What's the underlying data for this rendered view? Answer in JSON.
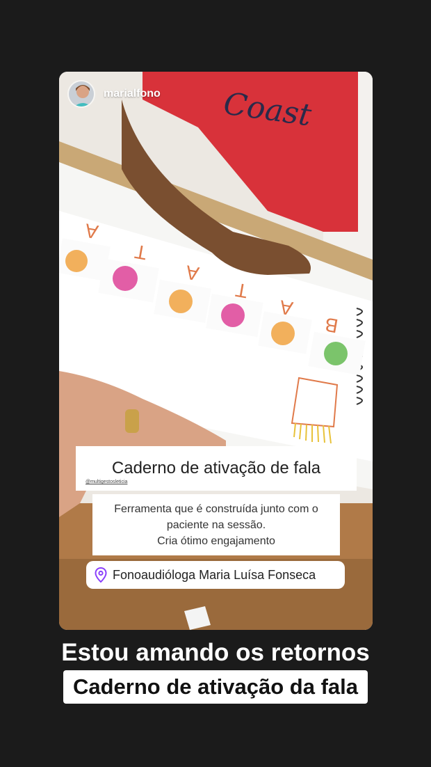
{
  "story": {
    "username": "marialfono",
    "title_sticker": "Caderno de ativação de fala",
    "credit": "@multigestosleticia",
    "description_lines": [
      "Ferramenta que é construída junto com o",
      "paciente na sessão.",
      "Cria ótimo engajamento"
    ],
    "location": "Fonoaudióloga Maria Luísa Fonseca",
    "shirt_text": "Coast",
    "word_letters": [
      "A",
      "T",
      "A",
      "T",
      "A",
      "B"
    ]
  },
  "caption": {
    "line1": "Estou amando os retornos",
    "line2": "Caderno de ativação da fala"
  },
  "colors": {
    "background": "#1b1b1b",
    "shirt": "#d8323a",
    "letters": "#e07a4a",
    "location_pin": "#8a3ffc"
  }
}
